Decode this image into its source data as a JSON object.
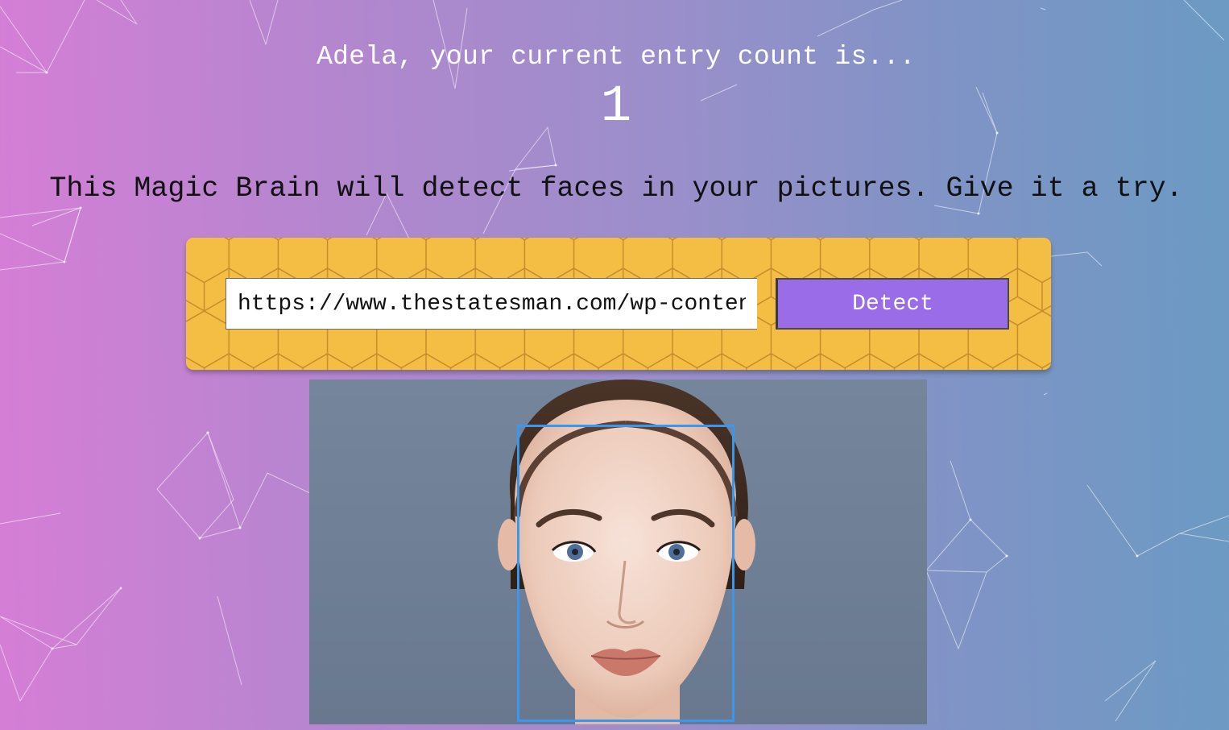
{
  "rank": {
    "greeting": "Adela, your current entry count is...",
    "count": "1"
  },
  "tagline": "This Magic Brain will detect faces in your pictures. Give it a try.",
  "image_form": {
    "url_value": "https://www.thestatesman.com/wp-content",
    "detect_label": "Detect"
  },
  "colors": {
    "background_start": "#d57ed6",
    "background_end": "#6b9ac3",
    "form_background": "#f4bd43",
    "button_background": "#9b6ce8",
    "bounding_box": "#3a97ee"
  }
}
